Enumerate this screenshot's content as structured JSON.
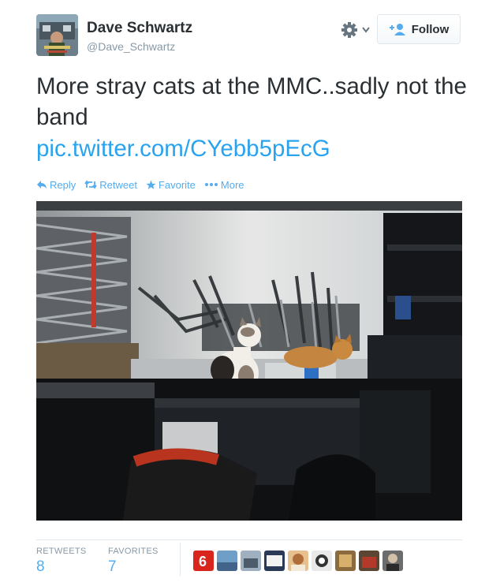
{
  "author": {
    "fullname": "Dave Schwartz",
    "username": "@Dave_Schwartz",
    "avatar_icon": "profile-photo-icon"
  },
  "header": {
    "settings_icon": "gear-icon",
    "follow_label": "Follow"
  },
  "tweet": {
    "text": "More stray cats at the MMC..sadly not the band",
    "link": "pic.twitter.com/CYebb5pEcG"
  },
  "actions": [
    {
      "label": "Reply",
      "icon": "reply-icon"
    },
    {
      "label": "Retweet",
      "icon": "retweet-icon"
    },
    {
      "label": "Favorite",
      "icon": "star-icon"
    },
    {
      "label": "More",
      "icon": "more-dots-icon"
    }
  ],
  "stats": {
    "retweets_label": "RETWEETS",
    "retweets_value": "8",
    "favorites_label": "FAVORITES",
    "favorites_value": "7"
  },
  "colors": {
    "link": "#2aa3ef",
    "muted": "#8899a6",
    "accent": "#55acee"
  }
}
